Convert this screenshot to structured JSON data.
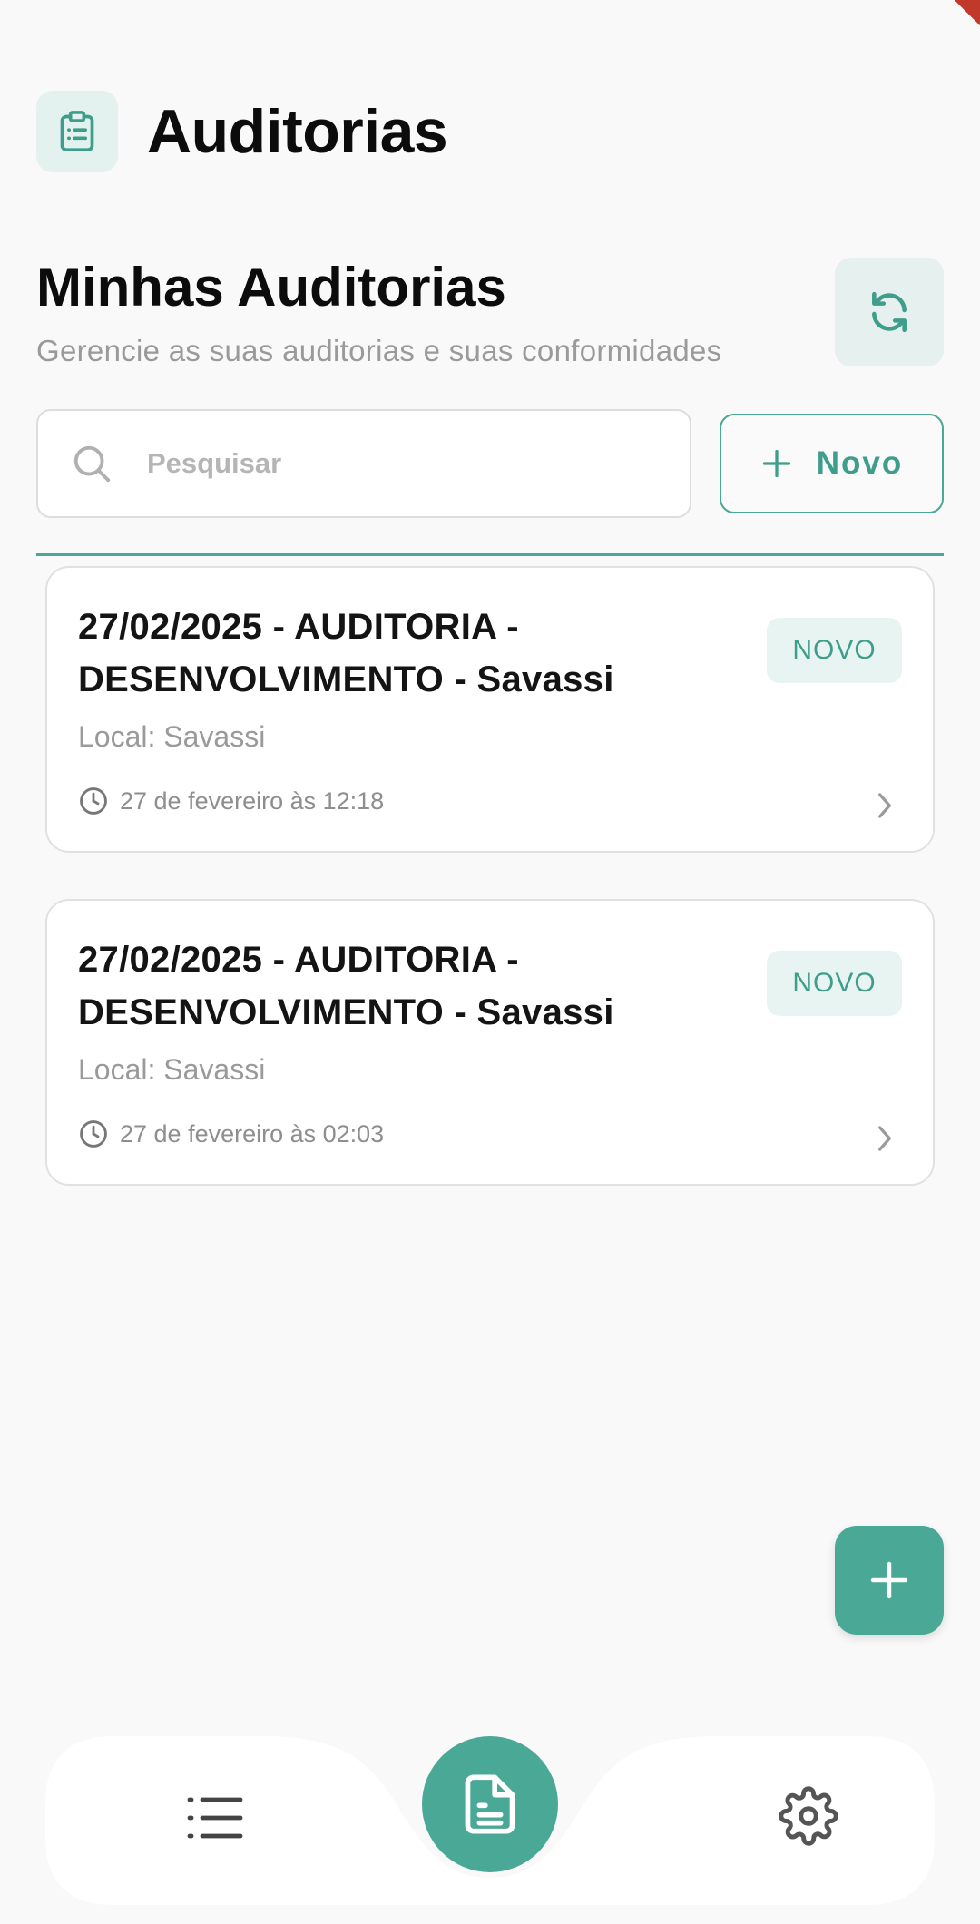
{
  "app": {
    "title": "Auditorias",
    "icon": "clipboard-icon",
    "accent_color": "#4aa896"
  },
  "section": {
    "title": "Minhas Auditorias",
    "subtitle": "Gerencie as suas auditorias e suas conformidades"
  },
  "toolbar": {
    "refresh_icon": "refresh-icon",
    "search_placeholder": "Pesquisar",
    "search_value": "",
    "new_label": "Novo"
  },
  "audits": [
    {
      "title": "27/02/2025 - AUDITORIA - DESENVOLVIMENTO - Savassi",
      "status": "NOVO",
      "location": "Local: Savassi",
      "time": "27 de fevereiro às 12:18"
    },
    {
      "title": "27/02/2025 - AUDITORIA - DESENVOLVIMENTO - Savassi",
      "status": "NOVO",
      "location": "Local: Savassi",
      "time": "27 de fevereiro às 02:03"
    }
  ],
  "bottom_nav": {
    "items": [
      {
        "icon": "list-icon"
      },
      {
        "icon": "document-icon",
        "active": true
      },
      {
        "icon": "gear-icon"
      }
    ]
  }
}
